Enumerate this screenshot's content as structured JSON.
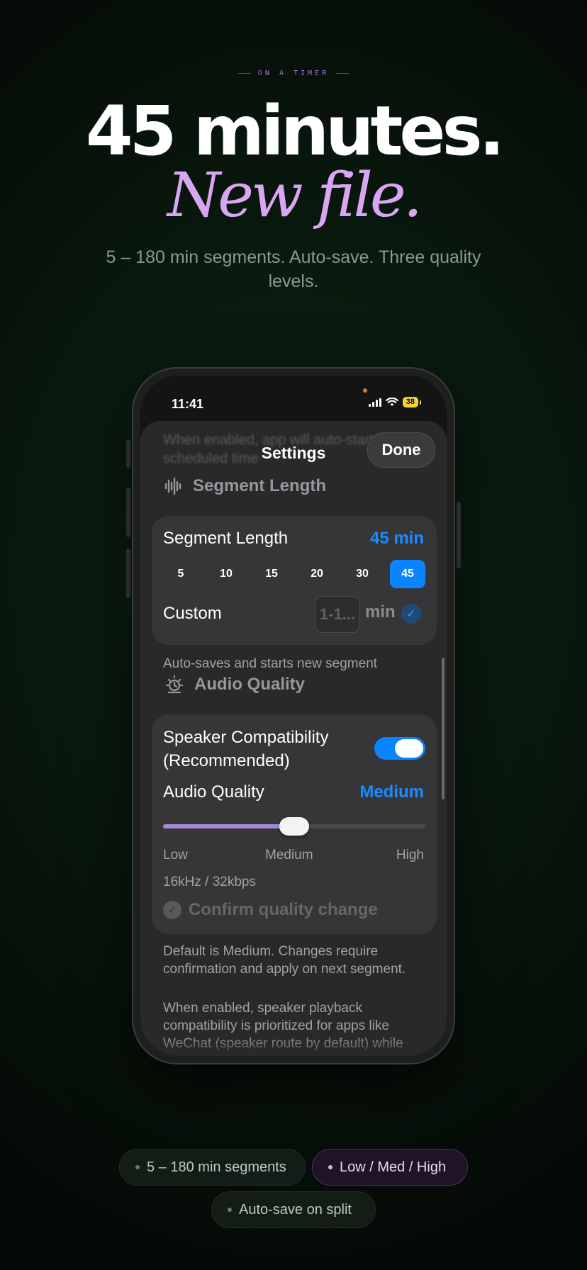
{
  "hero": {
    "kicker": "ON A TIMER",
    "headline": "45 minutes.",
    "subhead": "New file.",
    "description": "5 – 180 min segments. Auto-save. Three quality levels."
  },
  "status_bar": {
    "time": "11:41",
    "battery": "38",
    "icons": [
      "cellular-signal-icon",
      "wifi-icon",
      "battery-icon"
    ]
  },
  "sheet": {
    "title": "Settings",
    "done_label": "Done",
    "blurred_text": "When enabled, app will auto-start in scheduled time"
  },
  "segment_section": {
    "header": "Segment Length",
    "row_label": "Segment Length",
    "row_value": "45 min",
    "options": [
      "5",
      "10",
      "15",
      "20",
      "30",
      "45"
    ],
    "selected": "45",
    "custom_label": "Custom",
    "custom_placeholder": "1-1...",
    "custom_unit": "min",
    "footer": "Auto-saves and starts new segment"
  },
  "audio_section": {
    "header": "Audio Quality",
    "speaker_label": "Speaker Compatibility (Recommended)",
    "speaker_enabled": true,
    "quality_label": "Audio Quality",
    "quality_value": "Medium",
    "slider_level": 0.5,
    "ticks": [
      "Low",
      "Medium",
      "High"
    ],
    "bitrate": "16kHz / 32kbps",
    "confirm_label": "Confirm quality change",
    "footer_1": "Default is Medium. Changes require confirmation and apply on next segment.",
    "footer_2": "When enabled, speaker playback compatibility is prioritized for apps like WeChat (speaker route by default) while keeping recording"
  },
  "pills": [
    {
      "label": "5 – 180 min segments",
      "active": false
    },
    {
      "label": "Low / Med / High",
      "active": true
    },
    {
      "label": "Auto-save on split",
      "active": false
    }
  ],
  "colors": {
    "accent_blue": "#0a84ff",
    "accent_purple": "#d9a6f3",
    "slider_fill": "#a68ad9"
  }
}
